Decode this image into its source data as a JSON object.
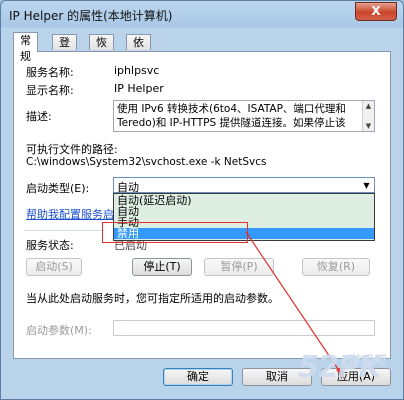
{
  "window": {
    "title": "IP Helper 的属性(本地计算机)",
    "close_label": "X"
  },
  "tabs": [
    {
      "label": "常规",
      "active": true
    },
    {
      "label": "登录",
      "active": false
    },
    {
      "label": "恢复",
      "active": false
    },
    {
      "label": "依存关系",
      "active": false
    }
  ],
  "service": {
    "name_label": "服务名称:",
    "name_value": "iphlpsvc",
    "display_label": "显示名称:",
    "display_value": "IP Helper",
    "desc_label": "描述:",
    "desc_line1": "使用 IPv6 转换技术(6to4、ISATAP、端口代理和",
    "desc_line2": "Teredo)和 IP-HTTPS 提供隧道连接。如果停止该",
    "path_label": "可执行文件的路径:",
    "path_value": "C:\\windows\\System32\\svchost.exe -k NetSvcs",
    "startup_label": "启动类型(E):",
    "startup_value": "自动",
    "startup_options": [
      "自动(延迟启动)",
      "自动",
      "手动",
      "禁用"
    ],
    "startup_highlighted_index": 3,
    "help_link": "帮助我配置服务启",
    "status_label": "服务状态:",
    "status_value": "已启动"
  },
  "buttons": {
    "start": "启动(S)",
    "stop": "停止(T)",
    "pause": "暂停(P)",
    "resume": "恢复(R)",
    "ok": "确定",
    "cancel": "取消",
    "apply": "应用(A)"
  },
  "hint_text": "当从此处启动服务时，您可指定所适用的启动参数。",
  "param_label": "启动参数(M):",
  "param_value": "",
  "watermark": {
    "brand": "52PK",
    "tail": "游戏网"
  },
  "colors": {
    "annotation_red": "#e0312b",
    "selection_blue": "#3399ff",
    "link_blue": "#1a4fcc"
  }
}
